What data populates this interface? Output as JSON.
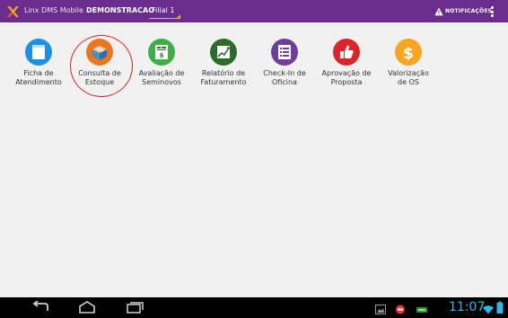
{
  "header": {
    "app_title": "Linx DMS Mobile",
    "account": "DEMONSTRACAO",
    "branch": "Filial 1",
    "notifications_label": "NOTIFICAÇÕES"
  },
  "tiles": [
    {
      "line1": "Ficha de",
      "line2": "Atendimento",
      "color": "#1e8fe1",
      "icon": "form-icon"
    },
    {
      "line1": "Consulta de",
      "line2": "Estoque",
      "color": "#e87722",
      "icon": "box-icon"
    },
    {
      "line1": "Avaliação de",
      "line2": "Seminovos",
      "color": "#3fae49",
      "icon": "money-document-icon"
    },
    {
      "line1": "Relatório de",
      "line2": "Faturamento",
      "color": "#2f6b2f",
      "icon": "chart-icon"
    },
    {
      "line1": "Check-In de",
      "line2": "Oficina",
      "color": "#6b3f9a",
      "icon": "checklist-icon"
    },
    {
      "line1": "Aprovação de",
      "line2": "Proposta",
      "color": "#d8262c",
      "icon": "thumbs-up-icon"
    },
    {
      "line1": "Valorização",
      "line2": "de OS",
      "color": "#f5a623",
      "icon": "dollar-icon"
    }
  ],
  "status": {
    "time": "11:07"
  },
  "colors": {
    "topbar": "#6a2d8e",
    "highlight": "#d81f26",
    "clock": "#33b5e5"
  }
}
